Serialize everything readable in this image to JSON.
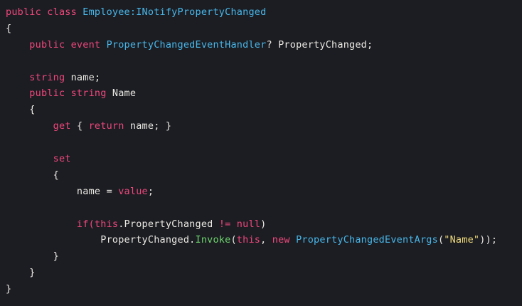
{
  "colors": {
    "background": "#1b1d23",
    "keyword": "#f0477a",
    "type": "#49b6e8",
    "identifier": "#ece9e2",
    "method": "#6ed36b",
    "string": "#f2dc7c"
  },
  "code": {
    "lines": [
      [
        {
          "t": "public class ",
          "c": "kw"
        },
        {
          "t": "Employee:INotifyPropertyChanged",
          "c": "type"
        }
      ],
      [
        {
          "t": "{",
          "c": "txt"
        }
      ],
      [
        {
          "t": "    public event ",
          "c": "kw"
        },
        {
          "t": "PropertyChangedEventHandler",
          "c": "type"
        },
        {
          "t": "? PropertyChanged;",
          "c": "txt"
        }
      ],
      [],
      [
        {
          "t": "    string ",
          "c": "kw"
        },
        {
          "t": "name;",
          "c": "txt"
        }
      ],
      [
        {
          "t": "    public string ",
          "c": "kw"
        },
        {
          "t": "Name",
          "c": "txt"
        }
      ],
      [
        {
          "t": "    {",
          "c": "txt"
        }
      ],
      [
        {
          "t": "        get ",
          "c": "kw"
        },
        {
          "t": "{ ",
          "c": "txt"
        },
        {
          "t": "return ",
          "c": "kw"
        },
        {
          "t": "name; }",
          "c": "txt"
        }
      ],
      [],
      [
        {
          "t": "        set",
          "c": "kw"
        }
      ],
      [
        {
          "t": "        {",
          "c": "txt"
        }
      ],
      [
        {
          "t": "            name = ",
          "c": "txt"
        },
        {
          "t": "value",
          "c": "kw"
        },
        {
          "t": ";",
          "c": "txt"
        }
      ],
      [],
      [
        {
          "t": "            if(this",
          "c": "kw"
        },
        {
          "t": ".PropertyChanged ",
          "c": "txt"
        },
        {
          "t": "!= null",
          "c": "kw"
        },
        {
          "t": ")",
          "c": "txt"
        }
      ],
      [
        {
          "t": "                PropertyChanged.",
          "c": "txt"
        },
        {
          "t": "Invoke",
          "c": "fn"
        },
        {
          "t": "(",
          "c": "txt"
        },
        {
          "t": "this",
          "c": "kw"
        },
        {
          "t": ", ",
          "c": "txt"
        },
        {
          "t": "new ",
          "c": "kw"
        },
        {
          "t": "PropertyChangedEventArgs",
          "c": "type"
        },
        {
          "t": "(",
          "c": "txt"
        },
        {
          "t": "\"Name\"",
          "c": "str"
        },
        {
          "t": "));",
          "c": "txt"
        }
      ],
      [
        {
          "t": "        }",
          "c": "txt"
        }
      ],
      [
        {
          "t": "    }",
          "c": "txt"
        }
      ],
      [
        {
          "t": "}",
          "c": "txt"
        }
      ]
    ]
  }
}
